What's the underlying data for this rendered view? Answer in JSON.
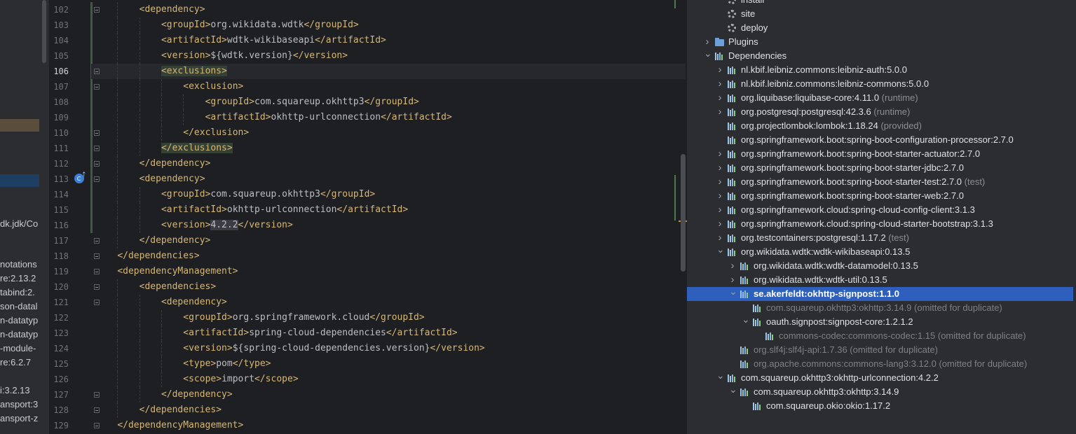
{
  "left_panel": {
    "items": [
      "dk.jdk/Co",
      "notations",
      "re:2.13.2",
      "tabind:2.",
      "son-datal",
      "n-datatyp",
      "n-datatyp",
      "-module-",
      "re:6.2.7",
      "i:3.2.13",
      "ansport:3",
      "ansport-z"
    ]
  },
  "editor": {
    "current_line": 106,
    "lines": [
      {
        "n": 102,
        "indent": 2,
        "parts": [
          [
            "tag",
            "<dependency>"
          ]
        ]
      },
      {
        "n": 103,
        "indent": 3,
        "parts": [
          [
            "tag",
            "<groupId>"
          ],
          [
            "txt",
            "org.wikidata.wdtk"
          ],
          [
            "tag",
            "</groupId>"
          ]
        ]
      },
      {
        "n": 104,
        "indent": 3,
        "parts": [
          [
            "tag",
            "<artifactId>"
          ],
          [
            "txt",
            "wdtk-wikibaseapi"
          ],
          [
            "tag",
            "</artifactId>"
          ]
        ]
      },
      {
        "n": 105,
        "indent": 3,
        "parts": [
          [
            "tag",
            "<version>"
          ],
          [
            "txt",
            "${wdtk.version}"
          ],
          [
            "tag",
            "</version>"
          ]
        ]
      },
      {
        "n": 106,
        "indent": 3,
        "parts": [
          [
            "taghl",
            "<exclusions>"
          ]
        ]
      },
      {
        "n": 107,
        "indent": 4,
        "parts": [
          [
            "tag",
            "<exclusion>"
          ]
        ]
      },
      {
        "n": 108,
        "indent": 5,
        "parts": [
          [
            "tag",
            "<groupId>"
          ],
          [
            "txt",
            "com.squareup.okhttp3"
          ],
          [
            "tag",
            "</groupId>"
          ]
        ]
      },
      {
        "n": 109,
        "indent": 5,
        "parts": [
          [
            "tag",
            "<artifactId>"
          ],
          [
            "txt",
            "okhttp-urlconnection"
          ],
          [
            "tag",
            "</artifactId>"
          ]
        ]
      },
      {
        "n": 110,
        "indent": 4,
        "parts": [
          [
            "tag",
            "</exclusion>"
          ]
        ]
      },
      {
        "n": 111,
        "indent": 3,
        "parts": [
          [
            "taghl",
            "</exclusions>"
          ]
        ]
      },
      {
        "n": 112,
        "indent": 2,
        "parts": [
          [
            "tag",
            "</dependency>"
          ]
        ]
      },
      {
        "n": 113,
        "indent": 2,
        "parts": [
          [
            "tag",
            "<dependency>"
          ]
        ]
      },
      {
        "n": 114,
        "indent": 3,
        "parts": [
          [
            "tag",
            "<groupId>"
          ],
          [
            "txt",
            "com.squareup.okhttp3"
          ],
          [
            "tag",
            "</groupId>"
          ]
        ]
      },
      {
        "n": 115,
        "indent": 3,
        "parts": [
          [
            "tag",
            "<artifactId>"
          ],
          [
            "txt",
            "okhttp-urlconnection"
          ],
          [
            "tag",
            "</artifactId>"
          ]
        ]
      },
      {
        "n": 116,
        "indent": 3,
        "parts": [
          [
            "tag",
            "<version>"
          ],
          [
            "valhl",
            "4.2.2"
          ],
          [
            "tag",
            "</version>"
          ]
        ]
      },
      {
        "n": 117,
        "indent": 2,
        "parts": [
          [
            "tag",
            "</dependency>"
          ]
        ]
      },
      {
        "n": 118,
        "indent": 1,
        "parts": [
          [
            "tag",
            "</dependencies>"
          ]
        ]
      },
      {
        "n": 119,
        "indent": 1,
        "parts": [
          [
            "tag",
            "<dependencyManagement>"
          ]
        ]
      },
      {
        "n": 120,
        "indent": 2,
        "parts": [
          [
            "tag",
            "<dependencies>"
          ]
        ]
      },
      {
        "n": 121,
        "indent": 3,
        "parts": [
          [
            "tag",
            "<dependency>"
          ]
        ]
      },
      {
        "n": 122,
        "indent": 4,
        "parts": [
          [
            "tag",
            "<groupId>"
          ],
          [
            "txt",
            "org.springframework.cloud"
          ],
          [
            "tag",
            "</groupId>"
          ]
        ]
      },
      {
        "n": 123,
        "indent": 4,
        "parts": [
          [
            "tag",
            "<artifactId>"
          ],
          [
            "txt",
            "spring-cloud-dependencies"
          ],
          [
            "tag",
            "</artifactId>"
          ]
        ]
      },
      {
        "n": 124,
        "indent": 4,
        "parts": [
          [
            "tag",
            "<version>"
          ],
          [
            "txt",
            "${spring-cloud-dependencies.version}"
          ],
          [
            "tag",
            "</version>"
          ]
        ]
      },
      {
        "n": 125,
        "indent": 4,
        "parts": [
          [
            "tag",
            "<type>"
          ],
          [
            "txt",
            "pom"
          ],
          [
            "tag",
            "</type>"
          ]
        ]
      },
      {
        "n": 126,
        "indent": 4,
        "parts": [
          [
            "tag",
            "<scope>"
          ],
          [
            "txt",
            "import"
          ],
          [
            "tag",
            "</scope>"
          ]
        ]
      },
      {
        "n": 127,
        "indent": 3,
        "parts": [
          [
            "tag",
            "</dependency>"
          ]
        ]
      },
      {
        "n": 128,
        "indent": 2,
        "parts": [
          [
            "tag",
            "</dependencies>"
          ]
        ]
      },
      {
        "n": 129,
        "indent": 1,
        "parts": [
          [
            "tag",
            "</dependencyManagement>"
          ]
        ]
      }
    ]
  },
  "tree": {
    "rows": [
      {
        "level": 1,
        "chev": "",
        "icon": "gear",
        "label": "install",
        "scope": ""
      },
      {
        "level": 1,
        "chev": "",
        "icon": "gear",
        "label": "site",
        "scope": ""
      },
      {
        "level": 1,
        "chev": "",
        "icon": "gear",
        "label": "deploy",
        "scope": ""
      },
      {
        "level": 0,
        "chev": "right",
        "icon": "folder",
        "label": "Plugins",
        "scope": ""
      },
      {
        "level": 0,
        "chev": "down",
        "icon": "libfolder",
        "label": "Dependencies",
        "scope": ""
      },
      {
        "level": 1,
        "chev": "right",
        "icon": "lib",
        "label": "nl.kbif.leibniz.commons:leibniz-auth:5.0.0",
        "scope": ""
      },
      {
        "level": 1,
        "chev": "right",
        "icon": "lib",
        "label": "nl.kbif.leibniz.commons:leibniz-commons:5.0.0",
        "scope": ""
      },
      {
        "level": 1,
        "chev": "right",
        "icon": "lib",
        "label": "org.liquibase:liquibase-core:4.11.0",
        "scope": "(runtime)"
      },
      {
        "level": 1,
        "chev": "right",
        "icon": "lib",
        "label": "org.postgresql:postgresql:42.3.6",
        "scope": "(runtime)"
      },
      {
        "level": 1,
        "chev": "",
        "icon": "lib",
        "label": "org.projectlombok:lombok:1.18.24",
        "scope": "(provided)"
      },
      {
        "level": 1,
        "chev": "",
        "icon": "lib",
        "label": "org.springframework.boot:spring-boot-configuration-processor:2.7.0",
        "scope": ""
      },
      {
        "level": 1,
        "chev": "right",
        "icon": "lib",
        "label": "org.springframework.boot:spring-boot-starter-actuator:2.7.0",
        "scope": ""
      },
      {
        "level": 1,
        "chev": "right",
        "icon": "lib",
        "label": "org.springframework.boot:spring-boot-starter-jdbc:2.7.0",
        "scope": ""
      },
      {
        "level": 1,
        "chev": "right",
        "icon": "lib",
        "label": "org.springframework.boot:spring-boot-starter-test:2.7.0",
        "scope": "(test)"
      },
      {
        "level": 1,
        "chev": "right",
        "icon": "lib",
        "label": "org.springframework.boot:spring-boot-starter-web:2.7.0",
        "scope": ""
      },
      {
        "level": 1,
        "chev": "right",
        "icon": "lib",
        "label": "org.springframework.cloud:spring-cloud-config-client:3.1.3",
        "scope": ""
      },
      {
        "level": 1,
        "chev": "right",
        "icon": "lib",
        "label": "org.springframework.cloud:spring-cloud-starter-bootstrap:3.1.3",
        "scope": ""
      },
      {
        "level": 1,
        "chev": "right",
        "icon": "lib",
        "label": "org.testcontainers:postgresql:1.17.2",
        "scope": "(test)"
      },
      {
        "level": 1,
        "chev": "down",
        "icon": "lib",
        "label": "org.wikidata.wdtk:wdtk-wikibaseapi:0.13.5",
        "scope": ""
      },
      {
        "level": 2,
        "chev": "right",
        "icon": "lib",
        "label": "org.wikidata.wdtk:wdtk-datamodel:0.13.5",
        "scope": ""
      },
      {
        "level": 2,
        "chev": "right",
        "icon": "lib",
        "label": "org.wikidata.wdtk:wdtk-util:0.13.5",
        "scope": ""
      },
      {
        "level": 2,
        "chev": "down",
        "icon": "lib",
        "label": "se.akerfeldt:okhttp-signpost:1.1.0",
        "scope": "",
        "selected": true
      },
      {
        "level": 3,
        "chev": "",
        "icon": "lib",
        "label": "com.squareup.okhttp3:okhttp:3.14.9 (omitted for duplicate)",
        "scope": "",
        "dim": true
      },
      {
        "level": 3,
        "chev": "down",
        "icon": "lib",
        "label": "oauth.signpost:signpost-core:1.2.1.2",
        "scope": ""
      },
      {
        "level": 4,
        "chev": "",
        "icon": "lib",
        "label": "commons-codec:commons-codec:1.15 (omitted for duplicate)",
        "scope": "",
        "dim": true
      },
      {
        "level": 2,
        "chev": "",
        "icon": "lib",
        "label": "org.slf4j:slf4j-api:1.7.36 (omitted for duplicate)",
        "scope": "",
        "dim": true
      },
      {
        "level": 2,
        "chev": "",
        "icon": "lib",
        "label": "org.apache.commons:commons-lang3:3.12.0 (omitted for duplicate)",
        "scope": "",
        "dim": true
      },
      {
        "level": 1,
        "chev": "down",
        "icon": "lib",
        "label": "com.squareup.okhttp3:okhttp-urlconnection:4.2.2",
        "scope": ""
      },
      {
        "level": 2,
        "chev": "down",
        "icon": "lib",
        "label": "com.squareup.okhttp3:okhttp:3.14.9",
        "scope": ""
      },
      {
        "level": 3,
        "chev": "",
        "icon": "lib",
        "label": "com.squareup.okio:okio:1.17.2",
        "scope": ""
      }
    ]
  }
}
